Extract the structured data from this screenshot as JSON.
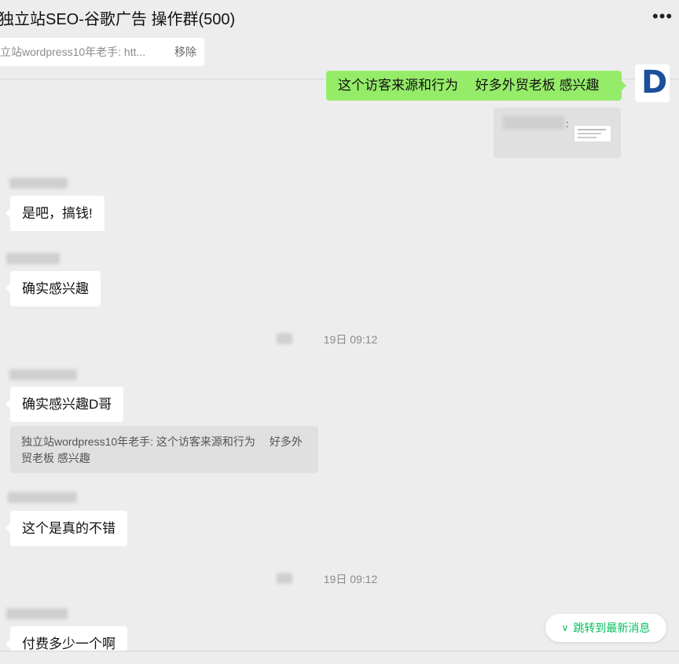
{
  "header": {
    "title": "独立站SEO-谷歌广告 操作群(500)",
    "more_icon": "more-horizontal-icon"
  },
  "pinned": {
    "text": "立站wordpress10年老手: htt...",
    "remove_label": "移除"
  },
  "messages": {
    "self_msg": "这个访客来源和行为　 好多外贸老板 感兴趣",
    "self_avatar_letter": "D",
    "quote_colon": ":",
    "msg1": "是吧，搞钱!",
    "msg2": "确实感兴趣",
    "time1": "19日 09:12",
    "msg3": "确实感兴趣D哥",
    "quote3": "独立站wordpress10年老手: 这个访客来源和行为　 好多外贸老板 感兴趣",
    "msg4": "这个是真的不错",
    "time2": "19日 09:12",
    "msg5": "付费多少一个啊"
  },
  "jump": {
    "label": "跳转到最新消息",
    "icon": "double-chevron-down-icon"
  },
  "colors": {
    "accent": "#07c160",
    "self_bubble": "#95ec69",
    "background": "#ededed"
  }
}
